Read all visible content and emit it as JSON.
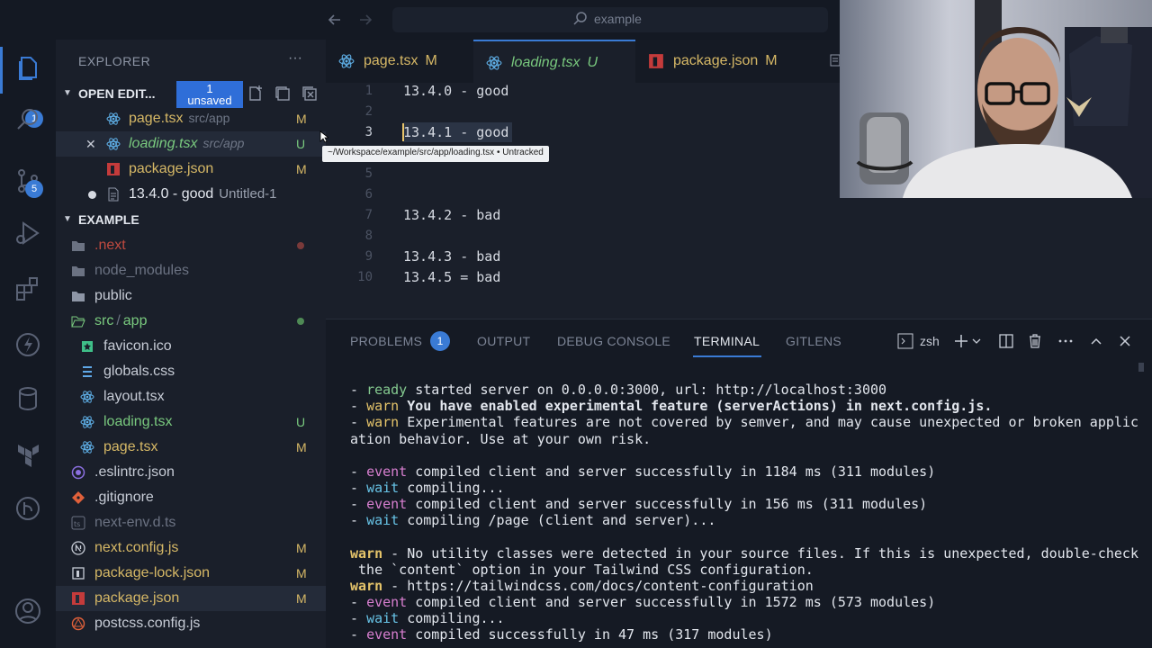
{
  "titlebar": {
    "search_text": "example"
  },
  "activity_bar": {
    "items": [
      {
        "name": "explorer",
        "badge": "1"
      },
      {
        "name": "search"
      },
      {
        "name": "source-control",
        "badge": "5"
      },
      {
        "name": "run-debug"
      },
      {
        "name": "extensions"
      },
      {
        "name": "thunder"
      },
      {
        "name": "database"
      },
      {
        "name": "terraform"
      },
      {
        "name": "git-graph"
      },
      {
        "name": "accounts"
      }
    ]
  },
  "sidebar": {
    "title": "EXPLORER",
    "more": "···",
    "open_editors": {
      "label": "OPEN EDIT...",
      "unsaved_count": "1",
      "unsaved_label": "unsaved",
      "items": [
        {
          "name": "page.tsx",
          "path": "src/app",
          "status": "M"
        },
        {
          "name": "loading.tsx",
          "path": "src/app",
          "status": "U",
          "close": "✕"
        },
        {
          "name": "package.json",
          "path": "",
          "status": "M"
        },
        {
          "name": "13.4.0 - good",
          "path": "Untitled-1",
          "status": ""
        }
      ]
    },
    "project": {
      "label": "EXAMPLE",
      "items": [
        {
          "name": ".next",
          "status": ""
        },
        {
          "name": "node_modules",
          "status": ""
        },
        {
          "name": "public",
          "status": ""
        },
        {
          "name": "src",
          "name2": "app",
          "sep": "/",
          "status": ""
        },
        {
          "name": "favicon.ico",
          "status": ""
        },
        {
          "name": "globals.css",
          "status": ""
        },
        {
          "name": "layout.tsx",
          "status": ""
        },
        {
          "name": "loading.tsx",
          "status": "U"
        },
        {
          "name": "page.tsx",
          "status": "M"
        },
        {
          "name": ".eslintrc.json",
          "status": ""
        },
        {
          "name": ".gitignore",
          "status": ""
        },
        {
          "name": "next-env.d.ts",
          "status": ""
        },
        {
          "name": "next.config.js",
          "status": "M"
        },
        {
          "name": "package-lock.json",
          "status": "M"
        },
        {
          "name": "package.json",
          "status": "M"
        },
        {
          "name": "postcss.config.js",
          "status": ""
        }
      ]
    }
  },
  "editor": {
    "tabs": [
      {
        "label": "page.tsx",
        "status": "M"
      },
      {
        "label": "loading.tsx",
        "status": "U"
      },
      {
        "label": "package.json",
        "status": "M"
      }
    ],
    "lines": [
      {
        "num": "1",
        "text": "13.4.0 - good"
      },
      {
        "num": "2",
        "text": ""
      },
      {
        "num": "3",
        "text": "13.4.1 - good"
      },
      {
        "num": "5",
        "text": ""
      },
      {
        "num": "6",
        "text": ""
      },
      {
        "num": "7",
        "text": "13.4.2 - bad"
      },
      {
        "num": "8",
        "text": ""
      },
      {
        "num": "9",
        "text": "13.4.3 - bad"
      },
      {
        "num": "10",
        "text": "13.4.5 = bad"
      }
    ],
    "tooltip": "~/Workspace/example/src/app/loading.tsx • Untracked"
  },
  "panel": {
    "tabs": {
      "problems": "PROBLEMS",
      "problems_count": "1",
      "output": "OUTPUT",
      "debug": "DEBUG CONSOLE",
      "terminal": "TERMINAL",
      "gitlens": "GITLENS"
    },
    "shell": "zsh",
    "terminal": {
      "l1": {
        "p": "- ",
        "k": "ready",
        "t": " started server on 0.0.0.0:3000, url: http://localhost:3000"
      },
      "l2": {
        "p": "- ",
        "k": "warn",
        "t": " You have enabled experimental feature (serverActions) in next.config.js."
      },
      "l3": {
        "p": "- ",
        "k": "warn",
        "t": " Experimental features are not covered by semver, and may cause unexpected or broken applic"
      },
      "l4": {
        "t": "ation behavior. Use at your own risk."
      },
      "l5": {
        "p": "- ",
        "k": "event",
        "t": " compiled client and server successfully in 1184 ms (311 modules)"
      },
      "l6": {
        "p": "- ",
        "k": "wait",
        "t": " compiling..."
      },
      "l7": {
        "p": "- ",
        "k": "event",
        "t": " compiled client and server successfully in 156 ms (311 modules)"
      },
      "l8": {
        "p": "- ",
        "k": "wait",
        "t": " compiling /page (client and server)..."
      },
      "l9": {
        "k": "warn",
        "t": " - No utility classes were detected in your source files. If this is unexpected, double-check"
      },
      "l10": {
        "t": " the `content` option in your Tailwind CSS configuration."
      },
      "l11": {
        "k": "warn",
        "t": " - https://tailwindcss.com/docs/content-configuration"
      },
      "l12": {
        "p": "- ",
        "k": "event",
        "t": " compiled client and server successfully in 1572 ms (573 modules)"
      },
      "l13": {
        "p": "- ",
        "k": "wait",
        "t": " compiling..."
      },
      "l14": {
        "p": "- ",
        "k": "event",
        "t": " compiled successfully in 47 ms (317 modules)"
      }
    }
  },
  "colors": {
    "accent": "#3a7bd5",
    "modified": "#d8b35a",
    "untracked": "#79c97e",
    "ignored": "#6b7282"
  }
}
